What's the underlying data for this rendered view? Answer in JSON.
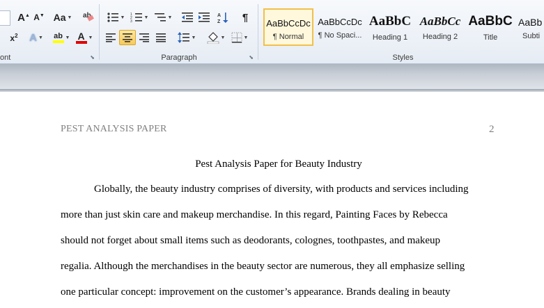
{
  "ribbon": {
    "font": {
      "grow_label": "A",
      "shrink_label": "A",
      "change_case_label": "Aa",
      "superscript_label": "x",
      "font_color_label": "A",
      "highlight_label": "ab",
      "highlight_color": "#ffff00",
      "font_color": "#e00000",
      "group_label": "ont"
    },
    "paragraph": {
      "group_label": "Paragraph",
      "pilcrow": "¶",
      "sort_label": "A Z"
    },
    "styles": {
      "group_label": "Styles",
      "items": [
        {
          "sample": "AaBbCcDc",
          "name": "¶ Normal"
        },
        {
          "sample": "AaBbCcDc",
          "name": "¶ No Spaci..."
        },
        {
          "sample": "AaBbC",
          "name": "Heading 1"
        },
        {
          "sample": "AaBbCc",
          "name": "Heading 2"
        },
        {
          "sample": "AaBbC",
          "name": "Title"
        },
        {
          "sample": "AaBb",
          "name": "Subti"
        }
      ]
    }
  },
  "document": {
    "header": "PEST ANALYSIS PAPER",
    "page_number": "2",
    "title": "Pest Analysis Paper for Beauty Industry",
    "lines": [
      "Globally, the beauty industry comprises of diversity, with products and services including",
      "more than just skin care and makeup merchandise. In this regard, Painting Faces by Rebecca",
      "should not forget about small items such as deodorants, colognes, toothpastes, and makeup",
      "regalia.  Although the merchandises in the beauty sector are numerous, they all emphasize selling",
      "one particular concept: improvement on the customer’s appearance. Brands dealing in beauty"
    ]
  }
}
